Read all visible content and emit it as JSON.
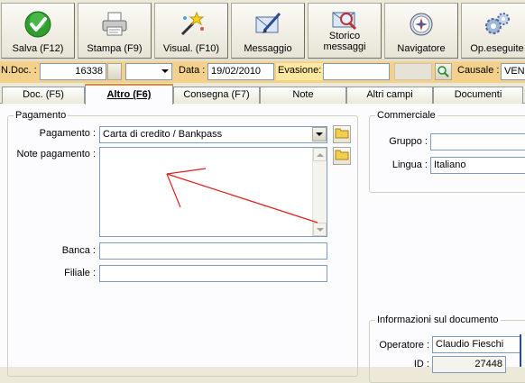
{
  "toolbar": {
    "buttons": [
      {
        "label": "Salva (F12)",
        "icon": "check-icon"
      },
      {
        "label": "Stampa (F9)",
        "icon": "printer-icon"
      },
      {
        "label": "Visual. (F10)",
        "icon": "magic-wand-icon"
      },
      {
        "label": "Messaggio",
        "icon": "envelope-pen-icon"
      },
      {
        "label": "Storico\nmessaggi",
        "icon": "envelope-search-icon"
      },
      {
        "label": "Navigatore",
        "icon": "compass-icon"
      },
      {
        "label": "Op.eseguite",
        "icon": "gears-icon"
      }
    ]
  },
  "docrow": {
    "ndoc_label": "N.Doc. :",
    "ndoc_value": "16338",
    "data_label": "Data :",
    "data_value": "19/02/2010",
    "evasione_label": "Evasione:",
    "evasione_value": "",
    "causale_label": "Causale :",
    "causale_value": "VENDI"
  },
  "tabs": [
    {
      "label": "Doc. (F5)",
      "active": false
    },
    {
      "label": "Altro (F6)",
      "active": true
    },
    {
      "label": "Consegna (F7)",
      "active": false
    },
    {
      "label": "Note",
      "active": false
    },
    {
      "label": "Altri campi",
      "active": false
    },
    {
      "label": "Documenti",
      "active": false
    }
  ],
  "pagamento": {
    "legend": "Pagamento",
    "pagamento_label": "Pagamento :",
    "pagamento_value": "Carta di credito / Bankpass",
    "note_label": "Note pagamento :",
    "note_value": "",
    "banca_label": "Banca :",
    "banca_value": "",
    "filiale_label": "Filiale :",
    "filiale_value": ""
  },
  "commerciale": {
    "legend": "Commerciale",
    "gruppo_label": "Gruppo :",
    "gruppo_value": "",
    "lingua_label": "Lingua :",
    "lingua_value": "Italiano"
  },
  "info": {
    "legend": "Informazioni sul documento",
    "operatore_label": "Operatore :",
    "operatore_value": "Claudio Fieschi",
    "id_label": "ID :",
    "id_value": "27448"
  },
  "annotation": {
    "color": "#e02020"
  },
  "colors": {
    "docrow_bg": "#f3d08b",
    "active_tab_accent": "#e68b2c"
  }
}
